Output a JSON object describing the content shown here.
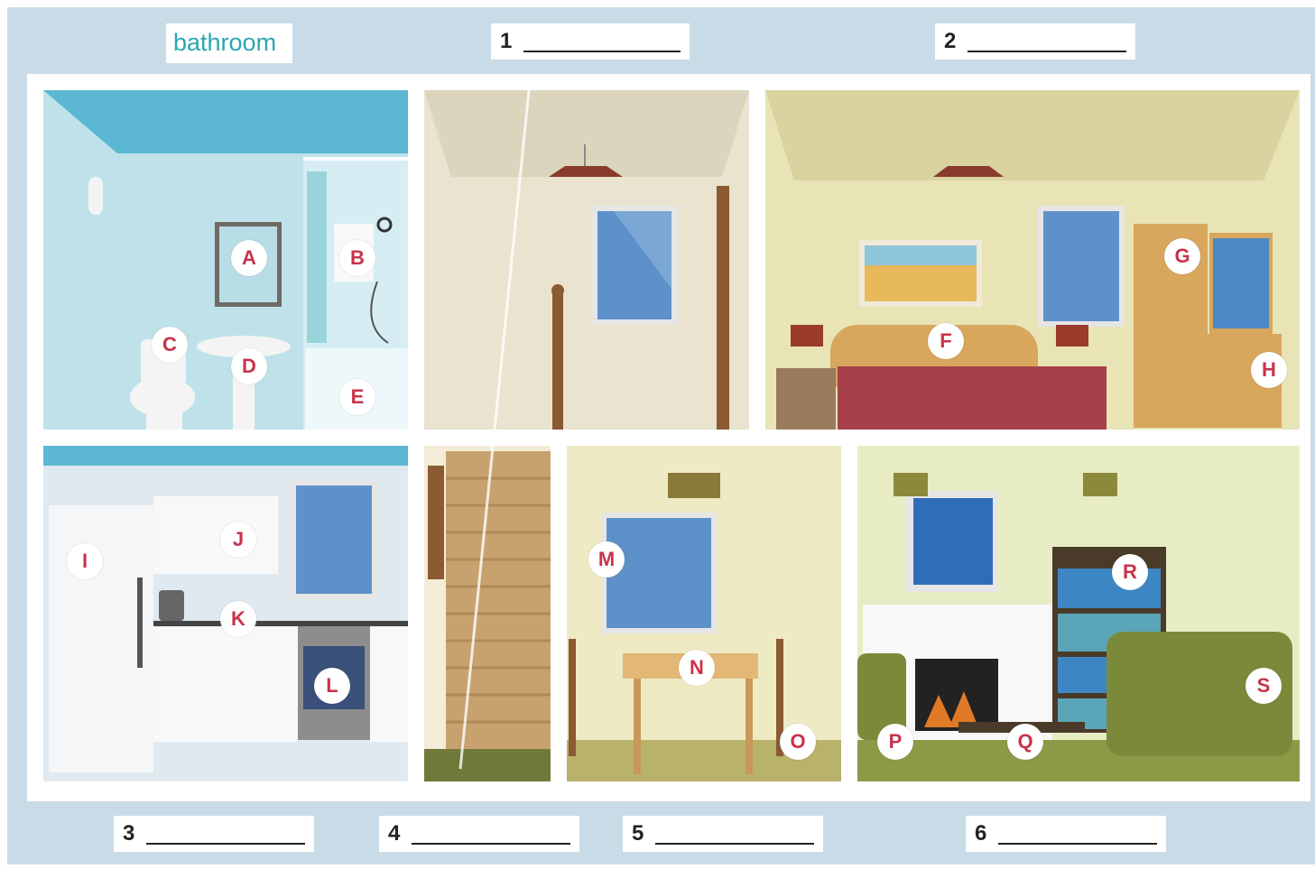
{
  "example_label": "bathroom",
  "blanks": [
    {
      "number": "1",
      "line": "__________"
    },
    {
      "number": "2",
      "line": "__________"
    },
    {
      "number": "3",
      "line": "__________"
    },
    {
      "number": "4",
      "line": "__________"
    },
    {
      "number": "5",
      "line": "__________"
    },
    {
      "number": "6",
      "line": "__________"
    }
  ],
  "item_letters": [
    "A",
    "B",
    "C",
    "D",
    "E",
    "F",
    "G",
    "H",
    "I",
    "J",
    "K",
    "L",
    "M",
    "N",
    "O",
    "P",
    "Q",
    "R",
    "S"
  ],
  "colors": {
    "label_text": "#c8334a",
    "example_text": "#2aa7b3",
    "frame": "#c9dbe6"
  }
}
